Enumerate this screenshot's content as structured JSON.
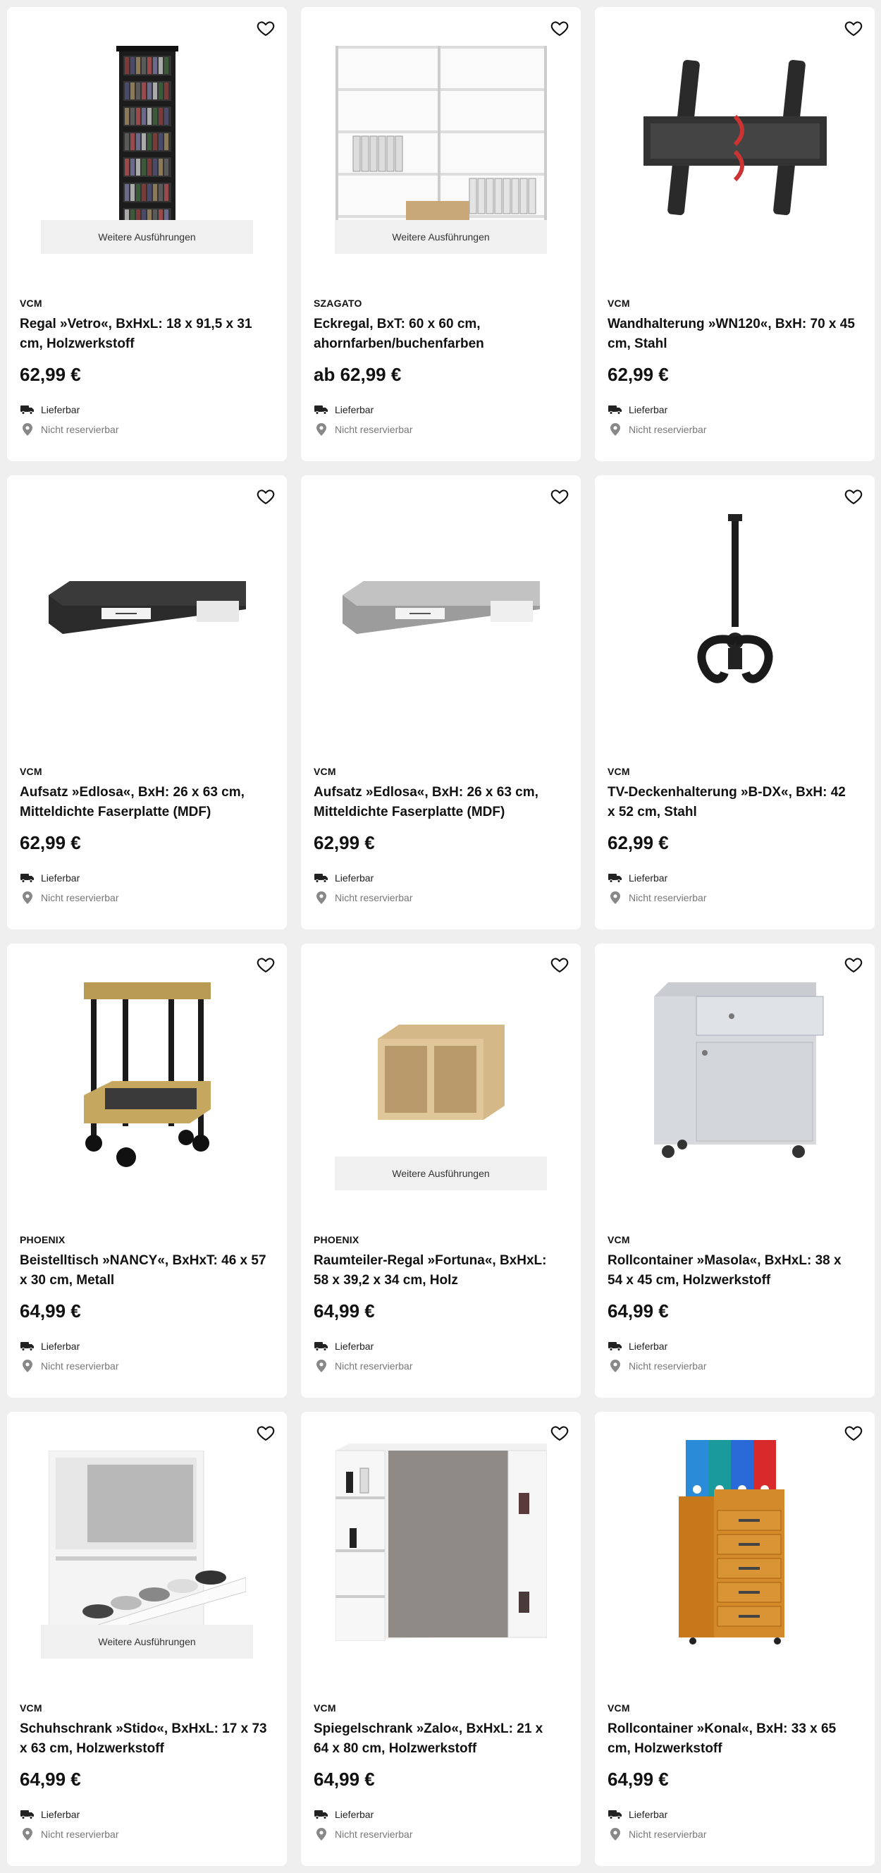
{
  "ui": {
    "more_label": "Weitere Ausführungen",
    "availability": "Lieferbar",
    "reservation": "Nicht reservierbar",
    "icons": {
      "favorite": "heart-outline-icon",
      "delivery": "truck-icon",
      "location": "map-pin-icon"
    }
  },
  "products": [
    {
      "brand": "VCM",
      "title": "Regal »Vetro«, BxHxL: 18 x 91,5 x 31 cm, Holzwerkstoff",
      "price": "62,99 €",
      "has_more": true,
      "image": "tall-dark-dvd-shelf"
    },
    {
      "brand": "SZAGATO",
      "title": "Eckregal, BxT: 60 x 60 cm, ahornfarben/buchenfarben",
      "price": "ab 62,99 €",
      "has_more": true,
      "image": "white-corner-shelf-with-folders"
    },
    {
      "brand": "VCM",
      "title": "Wandhalterung »WN120«, BxH: 70 x 45 cm, Stahl",
      "price": "62,99 €",
      "has_more": false,
      "image": "tv-wall-mount-tilt"
    },
    {
      "brand": "VCM",
      "title": "Aufsatz »Edlosa«, BxH: 26 x 63 cm, Mitteldichte Faserplatte (MDF)",
      "price": "62,99 €",
      "has_more": false,
      "image": "black-monitor-stand"
    },
    {
      "brand": "VCM",
      "title": "Aufsatz »Edlosa«, BxH: 26 x 63 cm, Mitteldichte Faserplatte (MDF)",
      "price": "62,99 €",
      "has_more": false,
      "image": "grey-monitor-stand"
    },
    {
      "brand": "VCM",
      "title": "TV-Deckenhalterung »B-DX«, BxH: 42 x 52 cm, Stahl",
      "price": "62,99 €",
      "has_more": false,
      "image": "tv-ceiling-mount"
    },
    {
      "brand": "PHOENIX",
      "title": "Beistelltisch »NANCY«, BxHxT: 46 x 57 x 30 cm, Metall",
      "price": "64,99 €",
      "has_more": false,
      "image": "side-trolley-wood-metal"
    },
    {
      "brand": "PHOENIX",
      "title": "Raumteiler-Regal »Fortuna«, BxHxL: 58 x 39,2 x 34 cm, Holz",
      "price": "64,99 €",
      "has_more": true,
      "image": "wooden-cube-shelf"
    },
    {
      "brand": "VCM",
      "title": "Rollcontainer »Masola«, BxHxL: 38 x 54 x 45 cm, Holzwerkstoff",
      "price": "64,99 €",
      "has_more": false,
      "image": "grey-rolling-container"
    },
    {
      "brand": "VCM",
      "title": "Schuhschrank »Stido«, BxHxL: 17 x 73 x 63 cm, Holzwerkstoff",
      "price": "64,99 €",
      "has_more": true,
      "image": "white-shoe-cabinet"
    },
    {
      "brand": "VCM",
      "title": "Spiegelschrank »Zalo«, BxHxL: 21 x 64 x 80 cm, Holzwerkstoff",
      "price": "64,99 €",
      "has_more": false,
      "image": "white-mirror-cabinet"
    },
    {
      "brand": "VCM",
      "title": "Rollcontainer »Konal«, BxH: 33 x 65 cm, Holzwerkstoff",
      "price": "64,99 €",
      "has_more": false,
      "image": "orange-drawer-container-with-folders"
    }
  ]
}
